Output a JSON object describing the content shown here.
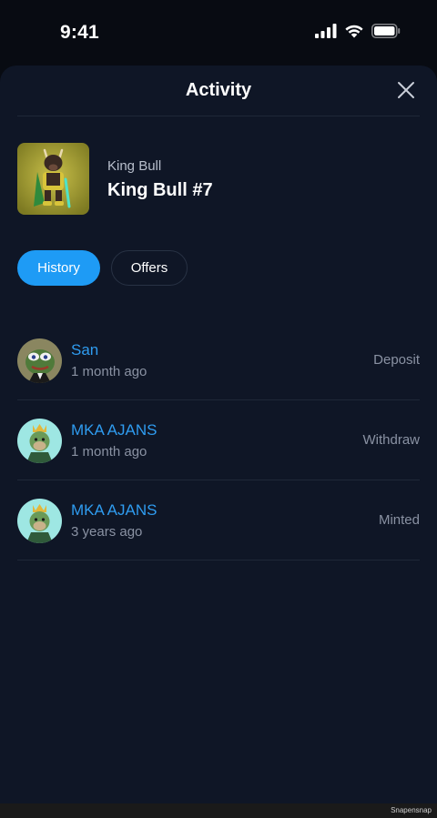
{
  "status_bar": {
    "time": "9:41"
  },
  "header": {
    "title": "Activity"
  },
  "nft": {
    "collection": "King Bull",
    "name": "King Bull #7"
  },
  "tabs": [
    {
      "label": "History",
      "active": true
    },
    {
      "label": "Offers",
      "active": false
    }
  ],
  "activity": [
    {
      "user": "San",
      "time": "1 month ago",
      "action": "Deposit",
      "avatar": "pepe-avatar"
    },
    {
      "user": "MKA AJANS",
      "time": "1 month ago",
      "action": "Withdraw",
      "avatar": "ape-avatar"
    },
    {
      "user": "MKA AJANS",
      "time": "3 years ago",
      "action": "Minted",
      "avatar": "ape-avatar"
    }
  ],
  "watermark": "Snapensnap",
  "colors": {
    "accent": "#1e9bf5",
    "link": "#2f9cf0",
    "sheet": "#0f1626",
    "background": "#080b12"
  }
}
